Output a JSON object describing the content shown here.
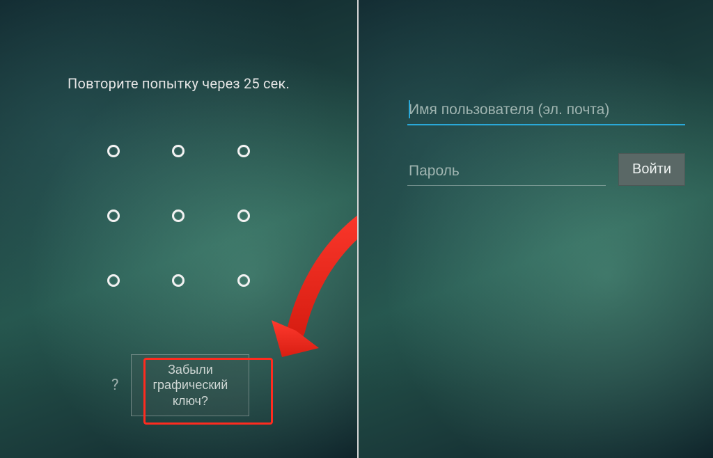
{
  "left": {
    "retry_message": "Повторите попытку через 25 сек.",
    "help_icon": "?",
    "forgot_button": "Забыли графический ключ?"
  },
  "right": {
    "username_placeholder": "Имя пользователя (эл. почта)",
    "password_placeholder": "Пароль",
    "login_button": "Войти"
  }
}
